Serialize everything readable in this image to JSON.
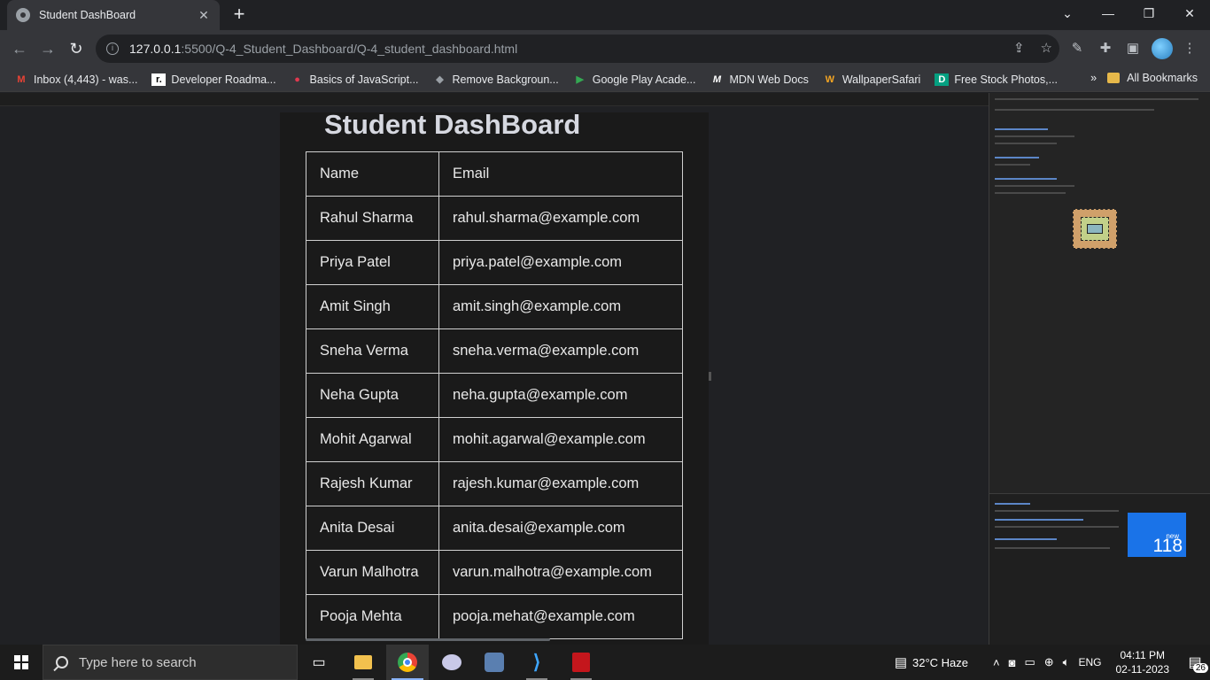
{
  "browser": {
    "tab_title": "Student DashBoard",
    "tab_close": "✕",
    "new_tab": "+",
    "url_host": "127.0.0.1",
    "url_path": ":5500/Q-4_Student_Dashboard/Q-4_student_dashboard.html"
  },
  "bookmarks": {
    "items": [
      {
        "label": "Inbox (4,443) - was...",
        "icon": "gmail-icon",
        "color": "#ea4335"
      },
      {
        "label": "Developer Roadma...",
        "icon": "roadmap-icon",
        "color": "#ffffff"
      },
      {
        "label": "Basics of JavaScript...",
        "icon": "spider-icon",
        "color": "#e0394f"
      },
      {
        "label": "Remove Backgroun...",
        "icon": "layers-icon",
        "color": "#9aa0a6"
      },
      {
        "label": "Google Play Acade...",
        "icon": "play-icon",
        "color": "#34a853"
      },
      {
        "label": "MDN Web Docs",
        "icon": "mdn-icon",
        "color": "#ffffff"
      },
      {
        "label": "WallpaperSafari",
        "icon": "w-icon",
        "color": "#f5a623"
      },
      {
        "label": "Free Stock Photos,...",
        "icon": "d-icon",
        "color": "#05a081"
      }
    ],
    "overflow": "»",
    "all_bookmarks": "All Bookmarks"
  },
  "page": {
    "heading": "Student DashBoard",
    "table": {
      "headers": [
        "Name",
        "Email"
      ],
      "rows": [
        [
          "Rahul Sharma",
          "rahul.sharma@example.com"
        ],
        [
          "Priya Patel",
          "priya.patel@example.com"
        ],
        [
          "Amit Singh",
          "amit.singh@example.com"
        ],
        [
          "Sneha Verma",
          "sneha.verma@example.com"
        ],
        [
          "Neha Gupta",
          "neha.gupta@example.com"
        ],
        [
          "Mohit Agarwal",
          "mohit.agarwal@example.com"
        ],
        [
          "Rajesh Kumar",
          "rajesh.kumar@example.com"
        ],
        [
          "Anita Desai",
          "anita.desai@example.com"
        ],
        [
          "Varun Malhotra",
          "varun.malhotra@example.com"
        ],
        [
          "Pooja Mehta",
          "pooja.mehat@example.com"
        ]
      ]
    }
  },
  "devtools": {
    "whatsnew_badge_word": "new",
    "whatsnew_badge_num": "118"
  },
  "taskbar": {
    "search_placeholder": "Type here to search",
    "weather": "32°C  Haze",
    "lang": "ENG",
    "time": "04:11 PM",
    "date": "02-11-2023",
    "notifications": "26"
  }
}
